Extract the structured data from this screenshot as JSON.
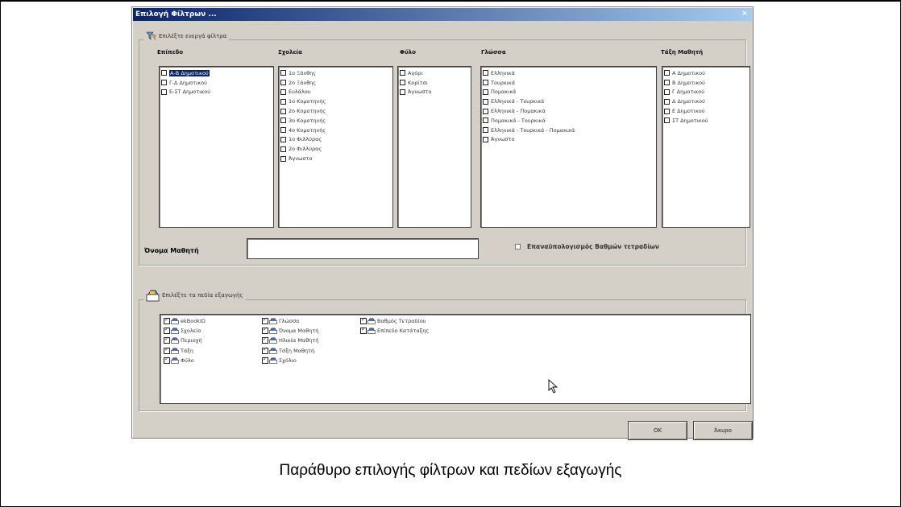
{
  "window": {
    "title": "Επιλογή Φίλτρων ...",
    "close_glyph": "×"
  },
  "filters": {
    "group_label": "Επιλέξτε ενεργά φίλτρα",
    "columns": [
      {
        "header": "Επίπεδο",
        "items": [
          {
            "label": "Α-Β Δημοτικού",
            "checked": false,
            "selected": true
          },
          {
            "label": "Γ-Δ Δημοτικού",
            "checked": false
          },
          {
            "label": "Ε-ΣΤ Δημοτικού",
            "checked": false
          }
        ]
      },
      {
        "header": "Σχολεία",
        "items": [
          {
            "label": "1ο Ξάνθης",
            "checked": false
          },
          {
            "label": "2ο Ξάνθης",
            "checked": false
          },
          {
            "label": "Ευλάλου",
            "checked": false
          },
          {
            "label": "1ο Κομοτηνής",
            "checked": false
          },
          {
            "label": "2ο Κομοτηνής",
            "checked": false
          },
          {
            "label": "3ο Κομοτηνής",
            "checked": false
          },
          {
            "label": "4ο Κομοτηνής",
            "checked": false
          },
          {
            "label": "1ο Φιλλύρας",
            "checked": false
          },
          {
            "label": "2ο Φιλλύρας",
            "checked": false
          },
          {
            "label": "Άγνωστο",
            "checked": false
          }
        ]
      },
      {
        "header": "Φύλο",
        "items": [
          {
            "label": "Αγόρι",
            "checked": false
          },
          {
            "label": "Κορίτσι",
            "checked": false
          },
          {
            "label": "Άγνωστο",
            "checked": false
          }
        ]
      },
      {
        "header": "Γλώσσα",
        "items": [
          {
            "label": "Ελληνικά",
            "checked": false
          },
          {
            "label": "Τουρκικά",
            "checked": false
          },
          {
            "label": "Πομακικά",
            "checked": false
          },
          {
            "label": "Ελληνικά - Τουρκικά",
            "checked": false
          },
          {
            "label": "Ελληνικά - Πομακικά",
            "checked": false
          },
          {
            "label": "Πομακικά - Τουρκικά",
            "checked": false
          },
          {
            "label": "Ελληνικά - Τουρκικά - Πομακικά",
            "checked": false
          },
          {
            "label": "Άγνωστο",
            "checked": false
          }
        ]
      },
      {
        "header": "Τάξη Μαθητή",
        "items": [
          {
            "label": "Α Δημοτικού",
            "checked": false
          },
          {
            "label": "Β Δημοτικού",
            "checked": false
          },
          {
            "label": "Γ Δημοτικού",
            "checked": false
          },
          {
            "label": "Δ Δημοτικού",
            "checked": false
          },
          {
            "label": "Ε Δημοτικού",
            "checked": false
          },
          {
            "label": "ΣΤ Δημοτικού",
            "checked": false
          }
        ]
      }
    ],
    "student_name_label": "Όνομα Μαθητή",
    "student_name_value": "",
    "recalc_label": "Επαναϋπολογισμός Βαθμών τετραδίων",
    "recalc_checked": false
  },
  "export": {
    "group_label": "Επιλέξτε τα πεδία εξαγωγής",
    "columns": [
      [
        "ekBookID",
        "Σχολείο",
        "Περιοχή",
        "Τάξη",
        "Φύλο"
      ],
      [
        "Γλώσσα",
        "Όνομα Μαθητή",
        "Ηλικία Μαθητή",
        "Τάξη Μαθητή",
        "Σχόλιο"
      ],
      [
        "Βαθμός Τετραδίου",
        "Επίπεδο Κατάταξης"
      ]
    ]
  },
  "buttons": {
    "ok": "OK",
    "cancel": "Άκυρο"
  },
  "caption": "Παράθυρο επιλογής φίλτρων και πεδίων εξαγωγής"
}
